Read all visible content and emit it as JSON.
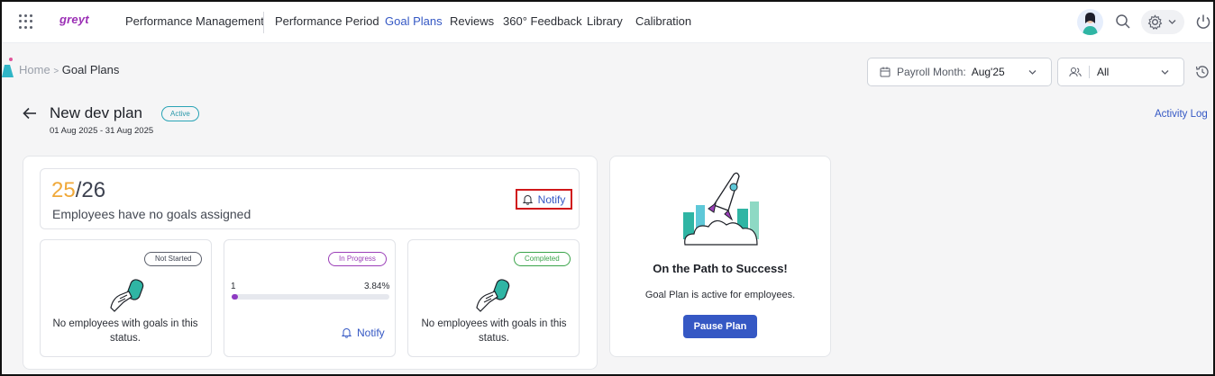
{
  "nav": {
    "logo": "greyt",
    "app_title": "Performance Management",
    "links": [
      "Performance Period",
      "Goal Plans",
      "Reviews",
      "360° Feedback",
      "Library",
      "Calibration"
    ],
    "active": "Goal Plans"
  },
  "breadcrumb": {
    "home": "Home",
    "separator": ">",
    "current": "Goal Plans"
  },
  "filters": {
    "payroll_label": "Payroll Month:",
    "payroll_value": "Aug'25",
    "group_value": "All"
  },
  "plan": {
    "title": "New dev plan",
    "status": "Active",
    "date_range": "01 Aug 2025 - 31 Aug 2025",
    "activity_log": "Activity Log"
  },
  "summary": {
    "count": "25",
    "total": "/26",
    "text": "Employees have no goals assigned",
    "notify": "Notify"
  },
  "status_cards": {
    "not_started": {
      "label": "Not Started",
      "empty_text": "No employees with goals in this status."
    },
    "in_progress": {
      "label": "In Progress",
      "count": "1",
      "percent": "3.84%",
      "progress": 0.0384,
      "notify": "Notify"
    },
    "completed": {
      "label": "Completed",
      "empty_text": "No employees with goals in this status."
    }
  },
  "success_card": {
    "title": "On the Path to Success!",
    "subtitle": "Goal Plan is active for employees.",
    "button": "Pause Plan"
  },
  "colors": {
    "accent": "#3558c4",
    "active_pill": "#2aa4b6",
    "not_started_pill": "#5b5f6b",
    "in_progress_pill": "#9b3fb8",
    "completed_pill": "#3aa44a",
    "count_highlight": "#f0a93a",
    "highlight_border": "#d0181b"
  }
}
